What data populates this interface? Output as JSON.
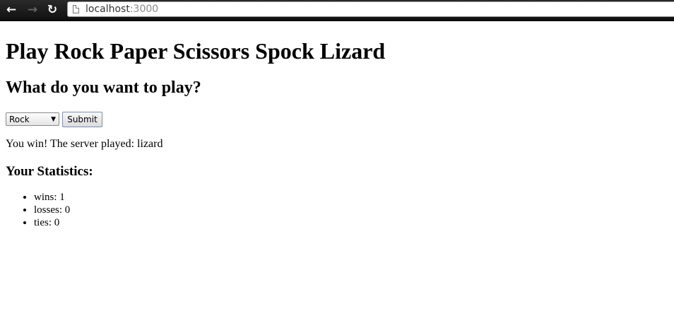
{
  "browser": {
    "url_host": "localhost",
    "url_port": ":3000",
    "back_icon": "arrow-left",
    "forward_icon": "arrow-right",
    "reload_icon": "reload"
  },
  "page": {
    "title": "Play Rock Paper Scissors Spock Lizard",
    "prompt": "What do you want to play?",
    "selected_move": "Rock",
    "submit_label": "Submit",
    "result": "You win! The server played: lizard",
    "stats_heading": "Your Statistics:",
    "stats": [
      "wins: 1",
      "losses: 0",
      "ties: 0"
    ]
  }
}
